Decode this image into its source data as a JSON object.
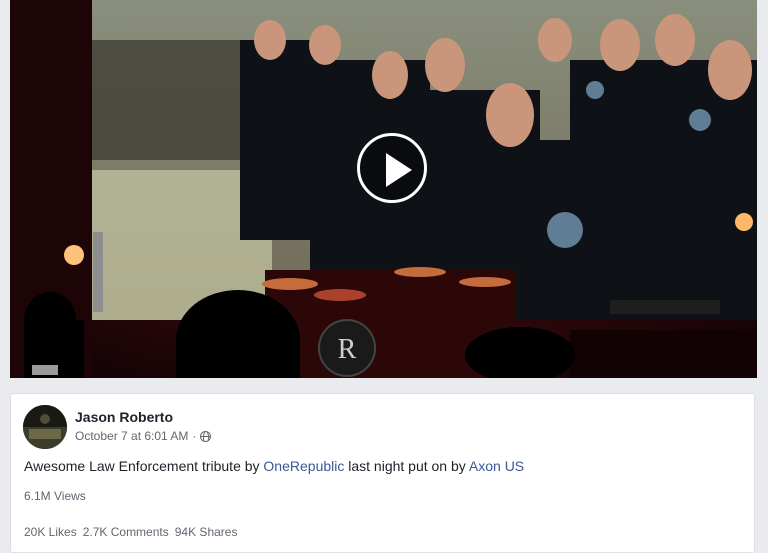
{
  "post": {
    "author": "Jason Roberto",
    "date": "October 7 at 6:01 AM",
    "separator": "·",
    "text_before": "Awesome Law Enforcement tribute by ",
    "mention_1": "OneRepublic",
    "text_middle": " last night put on by ",
    "mention_2": "Axon US",
    "views": "6.1M Views",
    "likes": "20K Likes",
    "comments": "2.7K Comments",
    "shares": "94K Shares"
  },
  "video": {
    "play_icon": "play-icon",
    "drum_logo": "R"
  },
  "colors": {
    "link": "#385898",
    "text": "#1d2129",
    "secondary": "#606770",
    "background": "#e9ebee"
  }
}
